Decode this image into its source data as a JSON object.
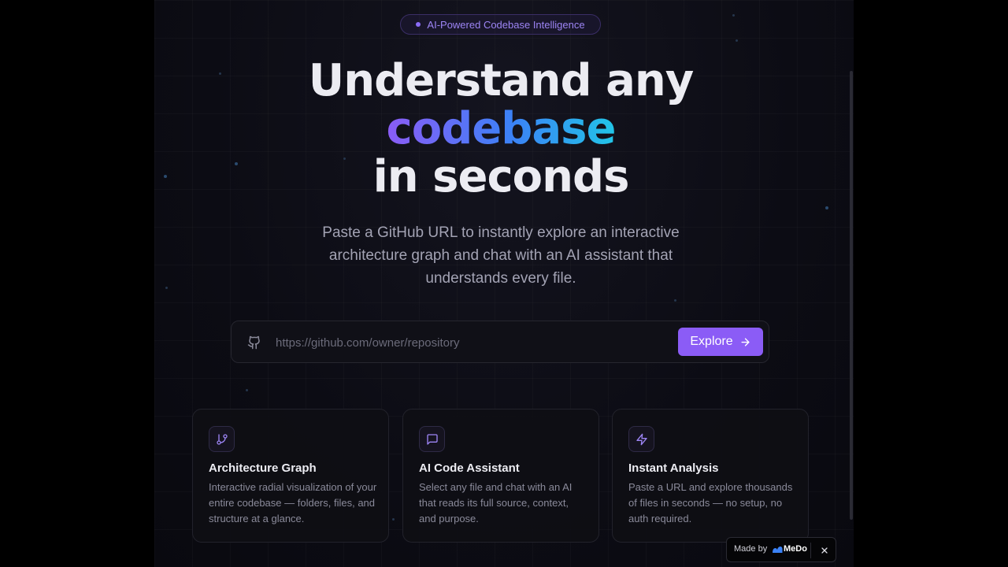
{
  "badge": {
    "text": "AI-Powered Codebase Intelligence"
  },
  "hero": {
    "line1": "Understand any",
    "line2": "codebase",
    "line3": "in seconds",
    "subtitle": "Paste a GitHub URL to instantly explore an interactive architecture graph and chat with an AI assistant that understands every file."
  },
  "search": {
    "placeholder": "https://github.com/owner/repository",
    "value": "",
    "button_label": "Explore",
    "icon": "github-icon"
  },
  "features": [
    {
      "icon": "git-branch-icon",
      "title": "Architecture Graph",
      "description": "Interactive radial visualization of your entire codebase — folders, files, and structure at a glance."
    },
    {
      "icon": "message-square-icon",
      "title": "AI Code Assistant",
      "description": "Select any file and chat with an AI that reads its full source, context, and purpose."
    },
    {
      "icon": "zap-icon",
      "title": "Instant Analysis",
      "description": "Paste a URL and explore thousands of files in seconds — no setup, no auth required."
    }
  ],
  "made_by": {
    "label": "Made by",
    "brand": "MeDo"
  },
  "colors": {
    "accent": "#8b5cf6",
    "gradient_start": "#8b5cf6",
    "gradient_mid": "#3b82f6",
    "gradient_end": "#22c5e8",
    "background": "#0c0c14"
  }
}
